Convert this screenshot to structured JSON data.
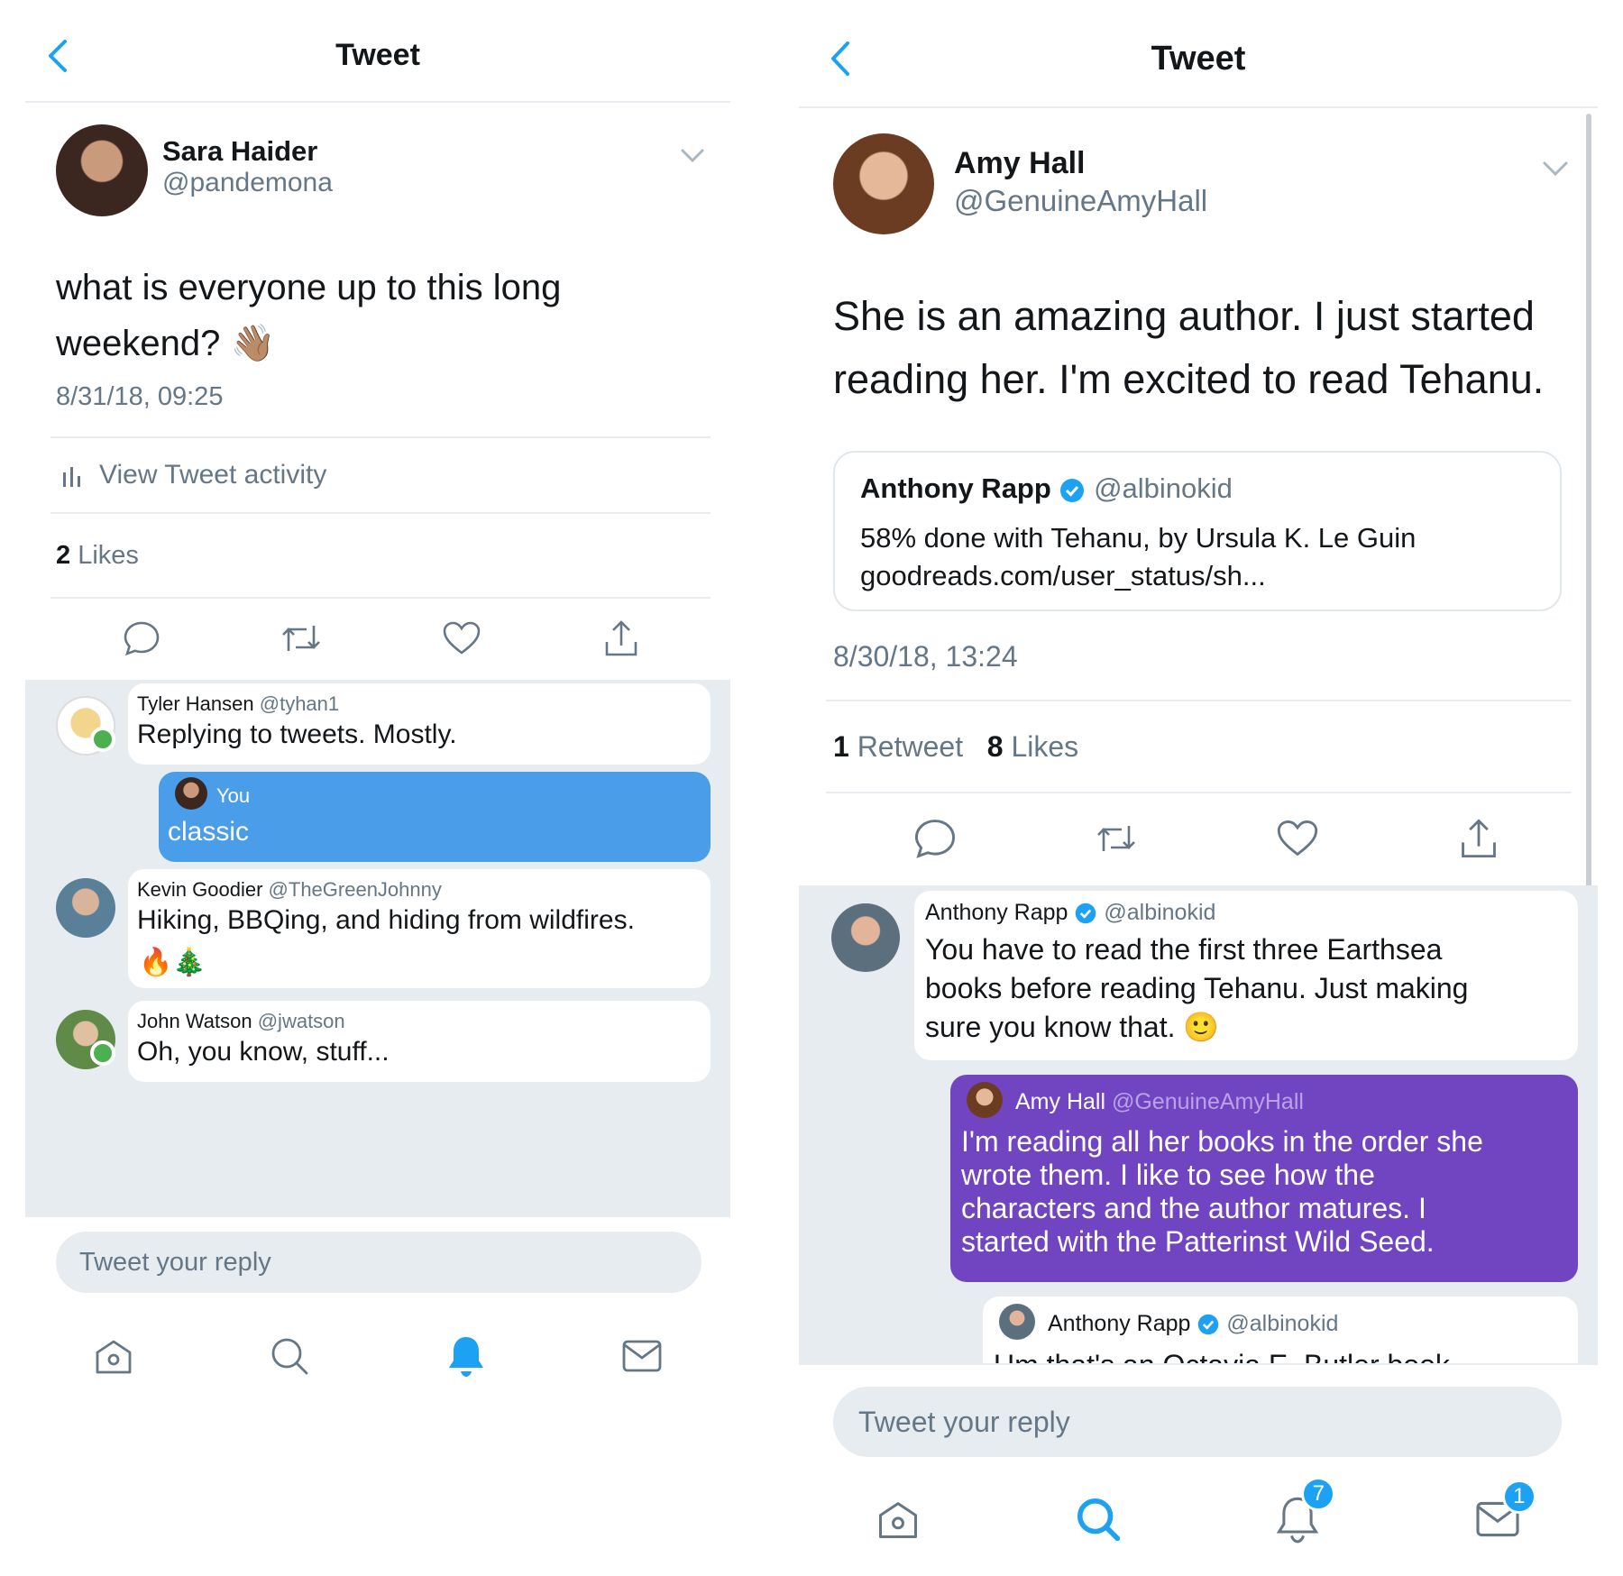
{
  "left": {
    "header": {
      "title": "Tweet"
    },
    "tweet": {
      "name": "Sara Haider",
      "handle": "@pandemona",
      "text": "what is everyone up to this long weekend?",
      "emoji": "👋🏽",
      "timestamp": "8/31/18, 09:25",
      "activity_label": "View Tweet activity",
      "likes_count": "2",
      "likes_label": "Likes"
    },
    "replies": [
      {
        "name": "Tyler Hansen",
        "handle": "@tyhan1",
        "text": "Replying to tweets. Mostly."
      },
      {
        "name": "You",
        "text": "classic"
      },
      {
        "name": "Kevin Goodier",
        "handle": "@TheGreenJohnny",
        "text": "Hiking, BBQing, and hiding from wildfires.",
        "emoji": "🔥🎄"
      },
      {
        "name": "John Watson",
        "handle": "@jwatson",
        "text": "Oh, you know, stuff..."
      }
    ],
    "reply_placeholder": "Tweet your reply"
  },
  "right": {
    "header": {
      "title": "Tweet"
    },
    "tweet": {
      "name": "Amy Hall",
      "handle": "@GenuineAmyHall",
      "text_line1": "She is an amazing author. I just started",
      "text_line2": "reading her.  I'm excited to read Tehanu.",
      "timestamp": "8/30/18, 13:24",
      "retweets_count": "1",
      "retweets_label": "Retweet",
      "likes_count": "8",
      "likes_label": "Likes"
    },
    "quote": {
      "name": "Anthony Rapp",
      "handle": "@albinokid",
      "text_line1": "58% done with Tehanu, by Ursula K. Le Guin",
      "text_line2": "goodreads.com/user_status/sh..."
    },
    "replies": [
      {
        "name": "Anthony Rapp",
        "handle": "@albinokid",
        "lines": [
          "You have to read the first three Earthsea",
          "books before reading Tehanu. Just making",
          "sure you know that."
        ],
        "emoji": "🙂"
      },
      {
        "name": "Amy Hall",
        "handle": "@GenuineAmyHall",
        "lines": [
          "I'm reading all her books in the order she",
          "wrote them.  I like to see how the",
          "characters and the author matures.  I",
          "started with the Patterinst Wild Seed."
        ]
      },
      {
        "name": "Anthony Rapp",
        "handle": "@albinokid",
        "partial_text": "Um that's an Octavia E. Butler book"
      }
    ],
    "reply_placeholder": "Tweet your reply",
    "badges": {
      "notifications": "7",
      "messages": "1"
    }
  },
  "colors": {
    "accent": "#1da1f2",
    "self_bubble": "#4a9de8",
    "purple_bubble": "#7145c2",
    "thread_bg": "#e6ecf0"
  }
}
